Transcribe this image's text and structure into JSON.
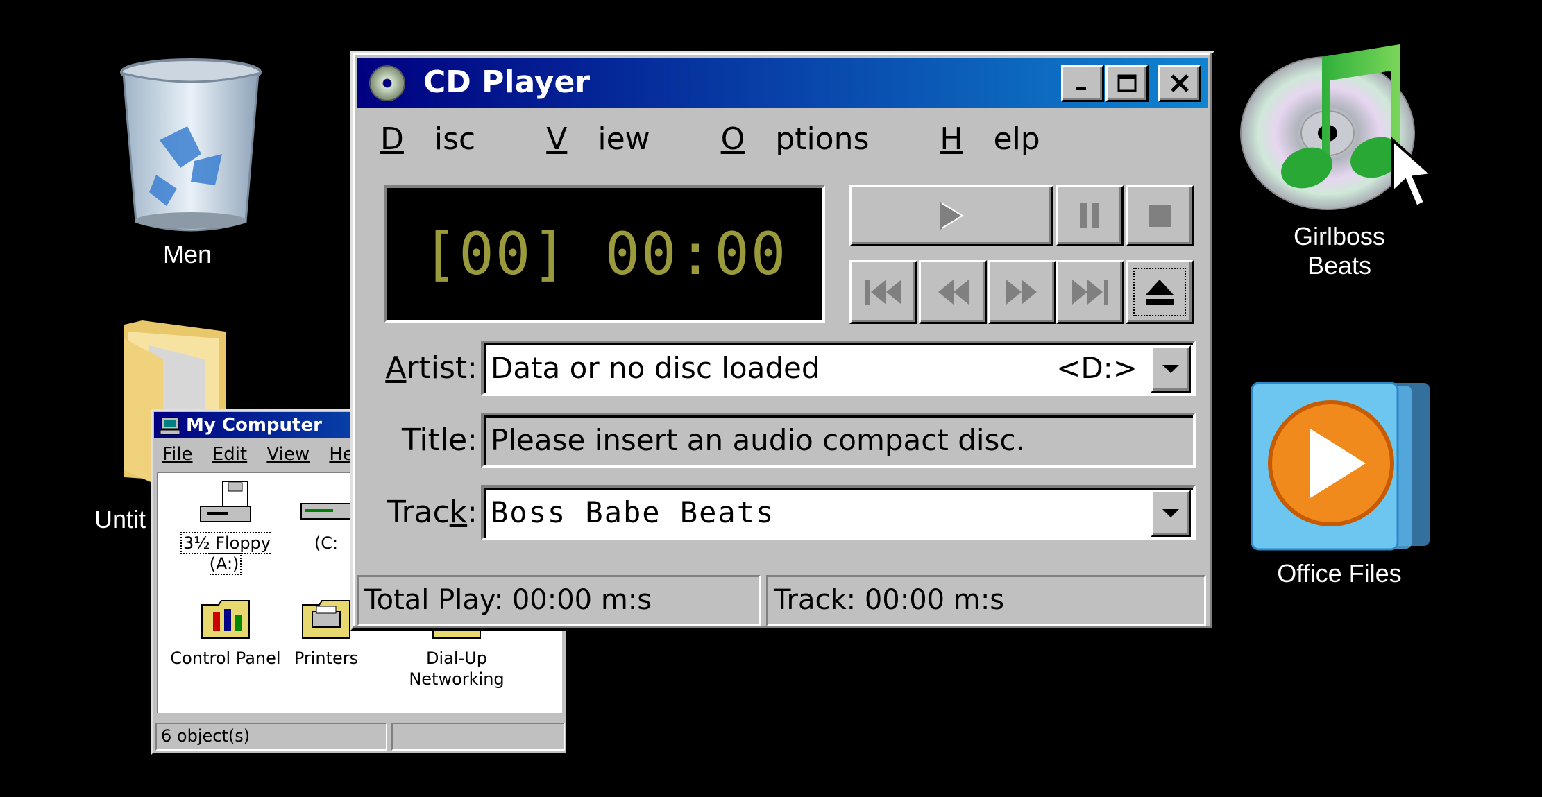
{
  "desktop": {
    "icons": [
      {
        "label": "Men",
        "icon": "recycle-bin-icon"
      },
      {
        "label": "Untit",
        "icon": "folder-icon"
      },
      {
        "label": "Girlboss\nBeats",
        "label_line1": "Girlboss",
        "label_line2": "Beats",
        "icon": "music-cd-icon"
      },
      {
        "label": "Office Files",
        "icon": "media-player-icon"
      }
    ]
  },
  "my_computer": {
    "title": "My Computer",
    "menu": [
      "File",
      "Edit",
      "View",
      "Help"
    ],
    "items": [
      {
        "label": "3½ Floppy (A:)",
        "icon": "floppy-drive-icon"
      },
      {
        "label": "(C:",
        "icon": "hard-drive-icon"
      },
      {
        "label": "Control Panel",
        "icon": "control-panel-icon"
      },
      {
        "label": "Printers",
        "icon": "printers-icon"
      },
      {
        "label_line1": "Dial-Up",
        "label_line2": "Networking",
        "icon": "dial-up-networking-icon"
      }
    ],
    "status": "6 object(s)"
  },
  "cd_player": {
    "title": "CD Player",
    "menu": {
      "disc": {
        "first": "D",
        "rest": "isc"
      },
      "view": {
        "first": "V",
        "rest": "iew"
      },
      "options": {
        "first": "O",
        "rest": "ptions"
      },
      "help": {
        "first": "H",
        "rest": "elp"
      }
    },
    "display": "[00] 00:00",
    "artist_label": {
      "pre": "",
      "u": "A",
      "post": "rtist:"
    },
    "artist_value": "Data or no disc loaded",
    "drive": "<D:>",
    "title_label": "Title:",
    "title_value": "Please insert an audio compact disc.",
    "track_label": {
      "pre": "Trac",
      "u": "k",
      "post": ":"
    },
    "track_value": "Boss Babe Beats",
    "total_play": "Total Play: 00:00 m:s",
    "track_time": "Track: 00:00 m:s",
    "lcd_color": "#9a9a3c",
    "titlebar_colors": [
      "#000080",
      "#1084d0"
    ]
  }
}
